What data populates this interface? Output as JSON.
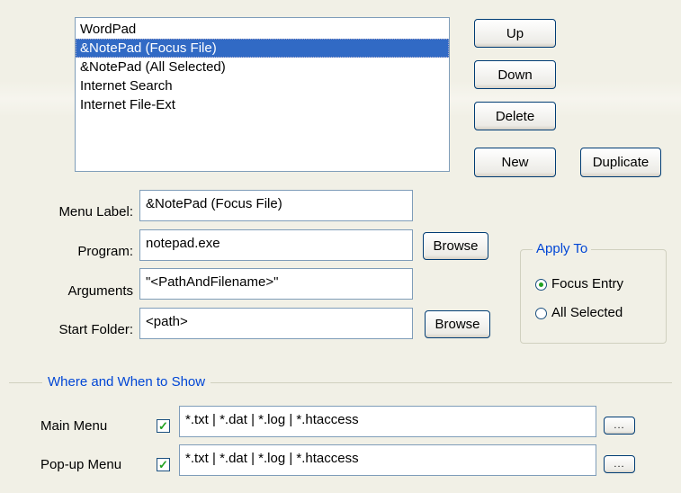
{
  "tools_list": {
    "items": [
      {
        "label": "WordPad",
        "selected": false
      },
      {
        "label": "&NotePad (Focus File)",
        "selected": true
      },
      {
        "label": "&NotePad (All Selected)",
        "selected": false
      },
      {
        "label": "Internet Search",
        "selected": false
      },
      {
        "label": "Internet File-Ext",
        "selected": false
      }
    ]
  },
  "buttons": {
    "up": "Up",
    "down": "Down",
    "delete": "Delete",
    "new": "New",
    "duplicate": "Duplicate",
    "browse": "Browse",
    "ellipsis": "..."
  },
  "form": {
    "menu_label": {
      "label": "Menu Label:",
      "value": "&NotePad (Focus File)"
    },
    "program": {
      "label": "Program:",
      "value": "notepad.exe"
    },
    "arguments": {
      "label": "Arguments",
      "value": "\"<PathAndFilename>\""
    },
    "start_folder": {
      "label": "Start Folder:",
      "value": "<path>"
    }
  },
  "apply_to": {
    "title": "Apply To",
    "options": [
      {
        "label": "Focus Entry",
        "checked": true
      },
      {
        "label": "All Selected",
        "checked": false
      }
    ]
  },
  "where_when": {
    "title": "Where and When to Show",
    "main_menu": {
      "label": "Main Menu",
      "checked": true,
      "value": "*.txt | *.dat | *.log | *.htaccess"
    },
    "popup_menu": {
      "label": "Pop-up Menu",
      "checked": true,
      "value": "*.txt | *.dat | *.log | *.htaccess"
    }
  },
  "colors": {
    "selection": "#316ac5",
    "group_title": "#0046d5",
    "check": "#21a121",
    "background": "#f1f0e6"
  }
}
